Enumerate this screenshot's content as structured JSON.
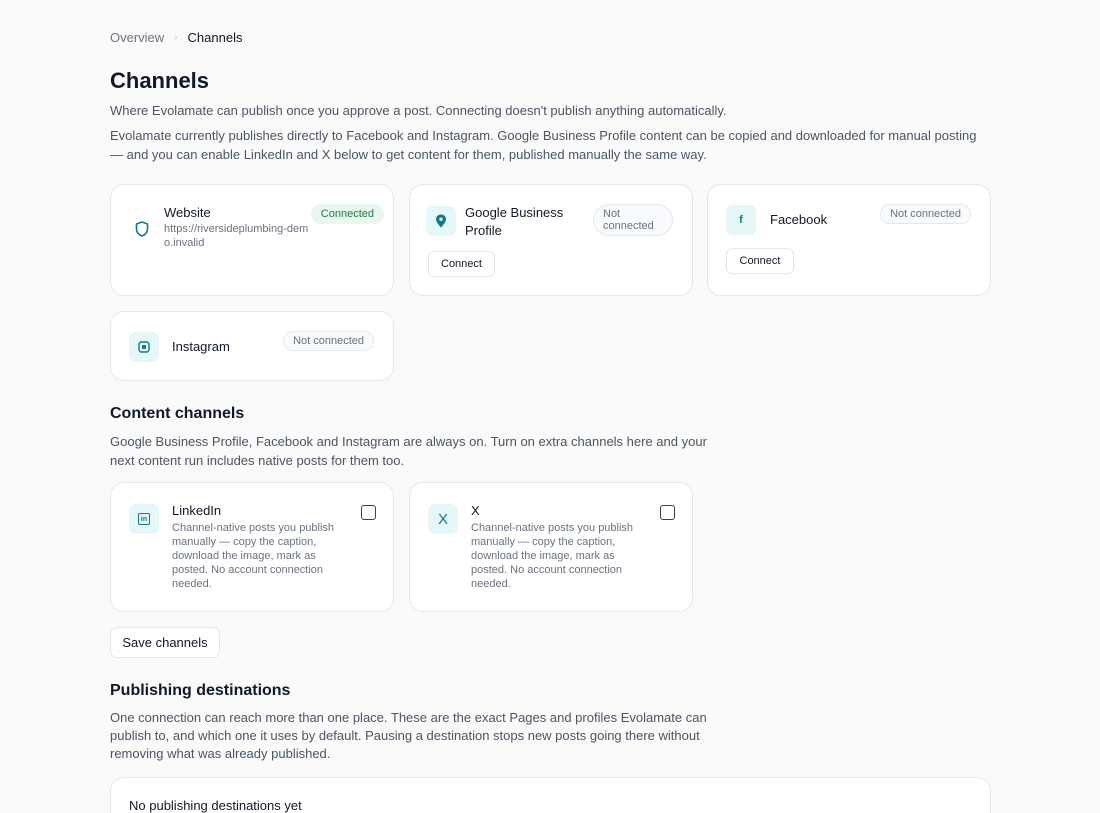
{
  "breadcrumb": {
    "parent": "Overview",
    "current": "Channels"
  },
  "page": {
    "title": "Channels",
    "intro": "Where Evolamate can publish once you approve a post. Connecting doesn't publish anything automatically.",
    "note": "Evolamate currently publishes directly to Facebook and Instagram. Google Business Profile content can be copied and downloaded for manual posting — and you can enable LinkedIn and X below to get content for them, published manually the same way."
  },
  "connections": {
    "website": {
      "name": "Website",
      "url": "https://riversideplumbing-demo.invalid",
      "status": "Connected",
      "icon": "shield-icon"
    },
    "google": {
      "name": "Google Business Profile",
      "status": "Not connected",
      "action": "Connect",
      "icon": "map-pin-icon"
    },
    "facebook": {
      "name": "Facebook",
      "status": "Not connected",
      "action": "Connect",
      "icon": "facebook-icon",
      "icon_glyph": "f"
    },
    "instagram": {
      "name": "Instagram",
      "status": "Not connected",
      "icon": "instagram-icon"
    }
  },
  "content_channels": {
    "title": "Content channels",
    "description": "Google Business Profile, Facebook and Instagram are always on. Turn on extra channels here and your next content run includes native posts for them too.",
    "linkedin": {
      "name": "LinkedIn",
      "icon_glyph": "in",
      "description": "Channel-native posts you publish manually — copy the caption, download the image, mark as posted. No account connection needed.",
      "icon": "linkedin-icon"
    },
    "x": {
      "name": "X",
      "icon_glyph": "X",
      "description": "Channel-native posts you publish manually — copy the caption, download the image, mark as posted. No account connection needed.",
      "icon": "x-icon"
    },
    "save_label": "Save channels"
  },
  "publishing": {
    "title": "Publishing destinations",
    "description": "One connection can reach more than one place. These are the exact Pages and profiles Evolamate can publish to, and which one it uses by default. Pausing a destination stops new posts going there without removing what was already published.",
    "empty": "No publishing destinations yet"
  },
  "colors": {
    "accent_bg": "#e6f7f8",
    "accent": "#0e7c86",
    "success_bg": "#e9f7ef",
    "success_text": "#1f7a47"
  }
}
